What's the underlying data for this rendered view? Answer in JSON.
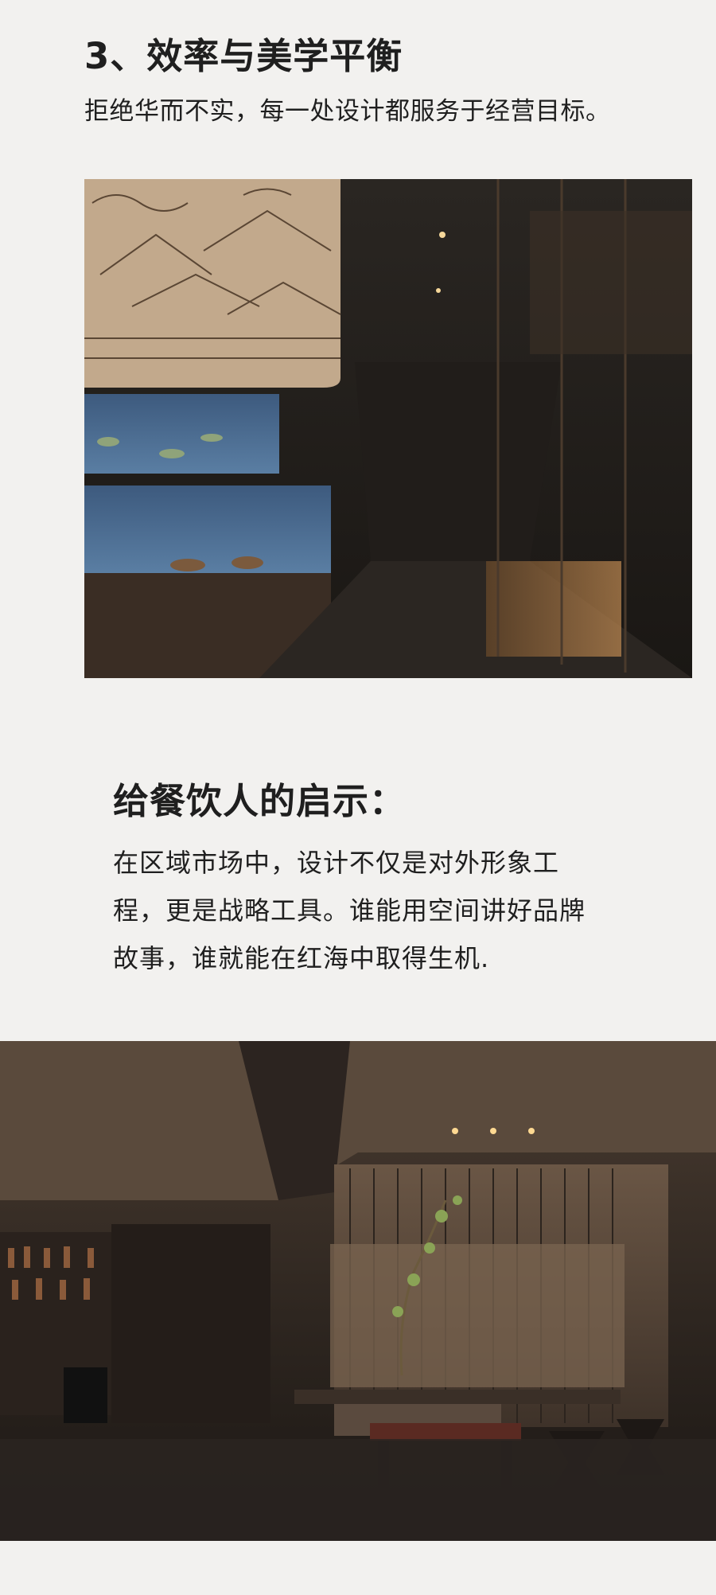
{
  "section3": {
    "heading": "3、效率与美学平衡",
    "subline": "拒绝华而不实，每一处设计都服务于经营目标。"
  },
  "takeaway": {
    "title": "给餐饮人的启示：",
    "lines": [
      "在区域市场中，设计不仅是对外形象工",
      "程，更是战略工具。谁能用空间讲好品牌",
      "故事，谁就能在红海中取得生机."
    ]
  },
  "colors": {
    "page_background": "#f2f1ef",
    "text": "#1f1f1f",
    "mural_tone": "#c2a98c",
    "aquarium_blue": "#4a6a8e",
    "interior_dark": "#2a2420"
  }
}
